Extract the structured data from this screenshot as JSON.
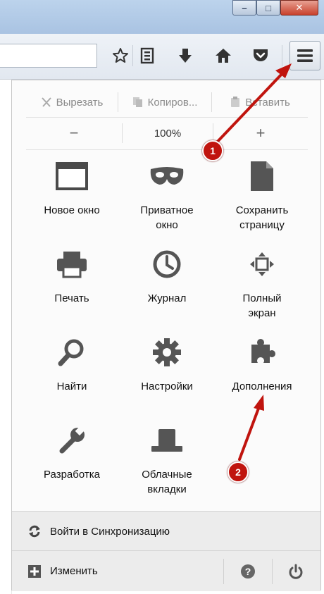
{
  "window": {
    "minimize_glyph": "–",
    "maximize_glyph": "□",
    "close_glyph": "✕"
  },
  "toolbar": {
    "icons": [
      "star-icon",
      "reading-list-icon",
      "download-icon",
      "home-icon",
      "pocket-icon",
      "hamburger-menu-icon"
    ]
  },
  "menu": {
    "edit": {
      "cut": "Вырезать",
      "copy": "Копиров...",
      "paste": "Вставить"
    },
    "zoom": {
      "minus": "−",
      "level": "100%",
      "plus": "+"
    },
    "items": [
      {
        "label": "Новое окно",
        "icon": "new-window-icon"
      },
      {
        "label": "Приватное окно",
        "icon": "private-window-mask-icon"
      },
      {
        "label": "Сохранить страницу",
        "icon": "save-page-icon"
      },
      {
        "label": "Печать",
        "icon": "print-icon"
      },
      {
        "label": "Журнал",
        "icon": "history-clock-icon"
      },
      {
        "label": "Полный экран",
        "icon": "fullscreen-icon"
      },
      {
        "label": "Найти",
        "icon": "find-icon"
      },
      {
        "label": "Настройки",
        "icon": "settings-gear-icon"
      },
      {
        "label": "Дополнения",
        "icon": "addons-puzzle-icon"
      },
      {
        "label": "Разработка",
        "icon": "developer-wrench-icon"
      },
      {
        "label": "Облачные вкладки",
        "icon": "synced-tabs-icon"
      }
    ],
    "sync_label": "Войти в Синхронизацию",
    "customize_label": "Изменить",
    "help_glyph": "?",
    "quit_icon": "power-icon"
  },
  "annotations": {
    "badge_1": "1",
    "badge_2": "2",
    "arrow_color": "#c0140e"
  }
}
